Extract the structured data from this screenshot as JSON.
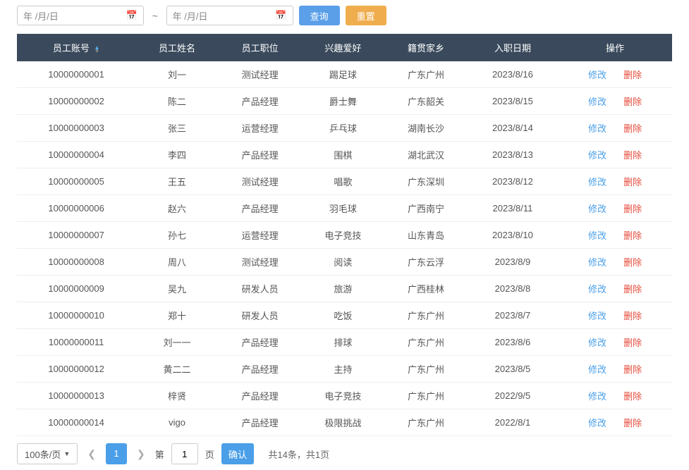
{
  "filter": {
    "date_from_placeholder": "年 /月/日",
    "date_tilde": "~",
    "date_to_placeholder": "年 /月/日",
    "query_label": "查询",
    "reset_label": "重置"
  },
  "table": {
    "headers": {
      "account": "员工账号",
      "name": "员工姓名",
      "position": "员工职位",
      "hobby": "兴趣爱好",
      "hometown": "籍贯家乡",
      "hire_date": "入职日期",
      "actions": "操作"
    },
    "rows": [
      {
        "account": "10000000001",
        "name": "刘一",
        "position": "测试经理",
        "hobby": "踢足球",
        "hometown": "广东广州",
        "hire_date": "2023/8/16"
      },
      {
        "account": "10000000002",
        "name": "陈二",
        "position": "产品经理",
        "hobby": "爵士舞",
        "hometown": "广东韶关",
        "hire_date": "2023/8/15"
      },
      {
        "account": "10000000003",
        "name": "张三",
        "position": "运营经理",
        "hobby": "乒乓球",
        "hometown": "湖南长沙",
        "hire_date": "2023/8/14"
      },
      {
        "account": "10000000004",
        "name": "李四",
        "position": "产品经理",
        "hobby": "围棋",
        "hometown": "湖北武汉",
        "hire_date": "2023/8/13"
      },
      {
        "account": "10000000005",
        "name": "王五",
        "position": "测试经理",
        "hobby": "唱歌",
        "hometown": "广东深圳",
        "hire_date": "2023/8/12"
      },
      {
        "account": "10000000006",
        "name": "赵六",
        "position": "产品经理",
        "hobby": "羽毛球",
        "hometown": "广西南宁",
        "hire_date": "2023/8/11"
      },
      {
        "account": "10000000007",
        "name": "孙七",
        "position": "运营经理",
        "hobby": "电子竞技",
        "hometown": "山东青岛",
        "hire_date": "2023/8/10"
      },
      {
        "account": "10000000008",
        "name": "周八",
        "position": "测试经理",
        "hobby": "阅读",
        "hometown": "广东云浮",
        "hire_date": "2023/8/9"
      },
      {
        "account": "10000000009",
        "name": "吴九",
        "position": "研发人员",
        "hobby": "旅游",
        "hometown": "广西桂林",
        "hire_date": "2023/8/8"
      },
      {
        "account": "10000000010",
        "name": "郑十",
        "position": "研发人员",
        "hobby": "吃饭",
        "hometown": "广东广州",
        "hire_date": "2023/8/7"
      },
      {
        "account": "10000000011",
        "name": "刘一一",
        "position": "产品经理",
        "hobby": "排球",
        "hometown": "广东广州",
        "hire_date": "2023/8/6"
      },
      {
        "account": "10000000012",
        "name": "黄二二",
        "position": "产品经理",
        "hobby": "主持",
        "hometown": "广东广州",
        "hire_date": "2023/8/5"
      },
      {
        "account": "10000000013",
        "name": "梓贤",
        "position": "产品经理",
        "hobby": "电子竞技",
        "hometown": "广东广州",
        "hire_date": "2022/9/5"
      },
      {
        "account": "10000000014",
        "name": "vigo",
        "position": "产品经理",
        "hobby": "极限挑战",
        "hometown": "广东广州",
        "hire_date": "2022/8/1"
      }
    ],
    "action_edit": "修改",
    "action_delete": "删除"
  },
  "pagination": {
    "page_size_label": "100条/页",
    "current_page": "1",
    "jump_label_prefix": "第",
    "jump_label_suffix": "页",
    "jump_input_value": "1",
    "confirm_label": "确认",
    "info": "共14条，共1页"
  }
}
